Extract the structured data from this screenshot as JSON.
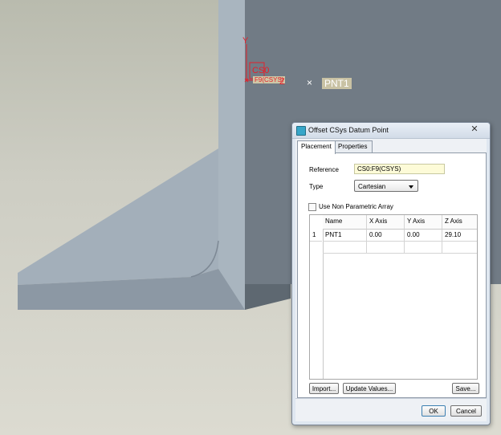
{
  "viewport": {
    "csys_label": "CS0",
    "feature_tag": "F9(CSYS)",
    "axis_y": "Y",
    "axis_z": "Z",
    "point_label": "PNT1",
    "point_marker": "×",
    "colors": {
      "part_face": "#9eaab4",
      "part_dark": "#6f7a84",
      "accent_red": "#e4202a"
    }
  },
  "dialog": {
    "title": "Offset CSys Datum Point",
    "close_glyph": "✕",
    "tabs": [
      {
        "label": "Placement",
        "active": true
      },
      {
        "label": "Properties",
        "active": false
      }
    ],
    "reference": {
      "label": "Reference",
      "value": "CS0:F9(CSYS)"
    },
    "type": {
      "label": "Type",
      "value": "Cartesian"
    },
    "non_parametric": {
      "label": "Use Non Parametric Array",
      "checked": false
    },
    "table": {
      "columns": [
        "Name",
        "X Axis",
        "Y Axis",
        "Z Axis"
      ],
      "rows": [
        {
          "index": "1",
          "name": "PNT1",
          "x": "0.00",
          "y": "0.00",
          "z": "29.10"
        }
      ]
    },
    "buttons": {
      "import": "Import...",
      "update": "Update Values...",
      "save": "Save...",
      "ok": "OK",
      "cancel": "Cancel"
    }
  }
}
